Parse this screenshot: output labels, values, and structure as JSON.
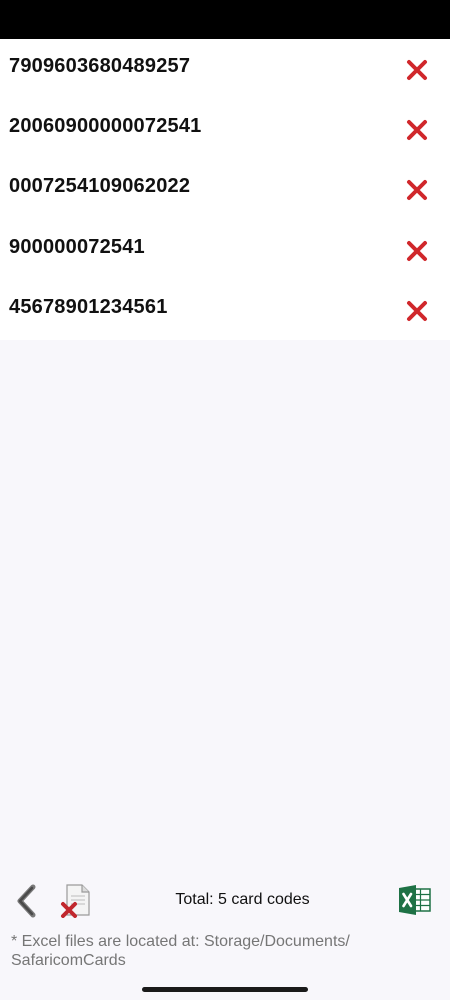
{
  "card_codes": [
    {
      "code": "7909603680489257"
    },
    {
      "code": "20060900000072541"
    },
    {
      "code": "0007254109062022"
    },
    {
      "code": "900000072541"
    },
    {
      "code": "45678901234561"
    }
  ],
  "footer": {
    "total_label": "Total: 5 card codes",
    "storage_note": "* Excel files are located at: Storage/Documents/ SafaricomCards"
  },
  "icons": {
    "delete": "close-x-icon",
    "back": "chevron-left-icon",
    "clear": "document-delete-icon",
    "export": "excel-icon"
  },
  "colors": {
    "delete_red": "#d0272b",
    "excel_green": "#1e7145",
    "list_background": "#ffffff",
    "page_background": "#f8f7fb"
  }
}
